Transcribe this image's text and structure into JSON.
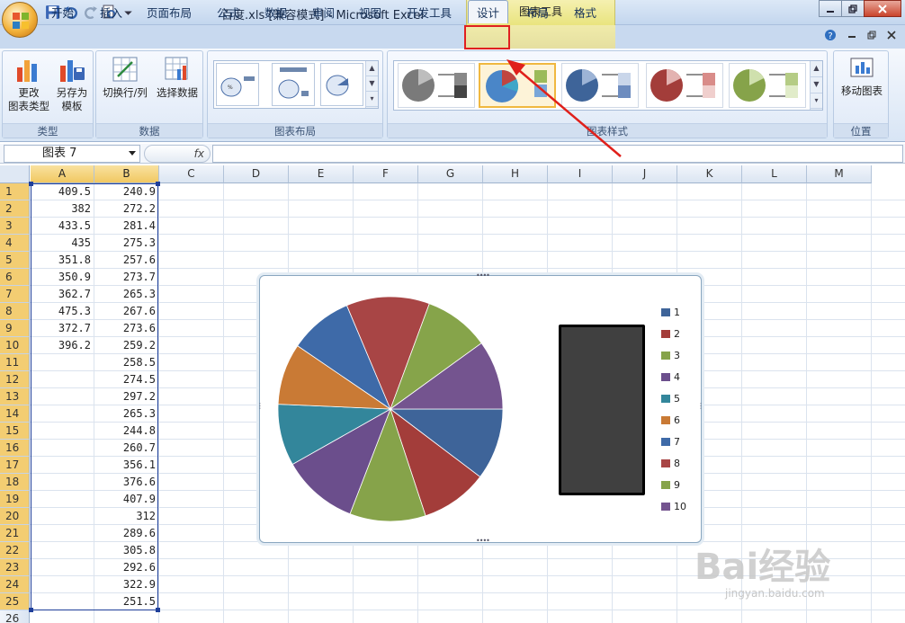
{
  "window": {
    "title": "百度.xls  [兼容模式] - Microsoft Excel",
    "context_title": "图表工具"
  },
  "tabs": [
    {
      "label": "开始"
    },
    {
      "label": "插入"
    },
    {
      "label": "页面布局"
    },
    {
      "label": "公式"
    },
    {
      "label": "数据"
    },
    {
      "label": "审阅"
    },
    {
      "label": "视图"
    },
    {
      "label": "开发工具"
    },
    {
      "label": "设计"
    },
    {
      "label": "布局"
    },
    {
      "label": "格式"
    }
  ],
  "active_tab": "设计",
  "ribbon": {
    "groups": {
      "type": {
        "label": "类型",
        "change_type": "更改\n图表类型",
        "save_template": "另存为\n模板"
      },
      "data": {
        "label": "数据",
        "switch_row_col": "切换行/列",
        "select_data": "选择数据"
      },
      "layout": {
        "label": "图表布局"
      },
      "styles": {
        "label": "图表样式"
      },
      "location": {
        "label": "位置",
        "move_chart": "移动图表"
      }
    }
  },
  "formula_bar": {
    "name_box": "图表 7",
    "fx": "fx",
    "content": ""
  },
  "columns": [
    "A",
    "B",
    "C",
    "D",
    "E",
    "F",
    "G",
    "H",
    "I",
    "J",
    "K",
    "L",
    "M"
  ],
  "rows": [
    {
      "n": "1",
      "a": "409.5",
      "b": "240.9"
    },
    {
      "n": "2",
      "a": "382",
      "b": "272.2"
    },
    {
      "n": "3",
      "a": "433.5",
      "b": "281.4"
    },
    {
      "n": "4",
      "a": "435",
      "b": "275.3"
    },
    {
      "n": "5",
      "a": "351.8",
      "b": "257.6"
    },
    {
      "n": "6",
      "a": "350.9",
      "b": "273.7"
    },
    {
      "n": "7",
      "a": "362.7",
      "b": "265.3"
    },
    {
      "n": "8",
      "a": "475.3",
      "b": "267.6"
    },
    {
      "n": "9",
      "a": "372.7",
      "b": "273.6"
    },
    {
      "n": "10",
      "a": "396.2",
      "b": "259.2"
    },
    {
      "n": "11",
      "a": "",
      "b": "258.5"
    },
    {
      "n": "12",
      "a": "",
      "b": "274.5"
    },
    {
      "n": "13",
      "a": "",
      "b": "297.2"
    },
    {
      "n": "14",
      "a": "",
      "b": "265.3"
    },
    {
      "n": "15",
      "a": "",
      "b": "244.8"
    },
    {
      "n": "16",
      "a": "",
      "b": "260.7"
    },
    {
      "n": "17",
      "a": "",
      "b": "356.1"
    },
    {
      "n": "18",
      "a": "",
      "b": "376.6"
    },
    {
      "n": "19",
      "a": "",
      "b": "407.9"
    },
    {
      "n": "20",
      "a": "",
      "b": "312"
    },
    {
      "n": "21",
      "a": "",
      "b": "289.6"
    },
    {
      "n": "22",
      "a": "",
      "b": "305.8"
    },
    {
      "n": "23",
      "a": "",
      "b": "292.6"
    },
    {
      "n": "24",
      "a": "",
      "b": "322.9"
    },
    {
      "n": "25",
      "a": "",
      "b": "251.5"
    },
    {
      "n": "26",
      "a": "",
      "b": ""
    }
  ],
  "chart_data": {
    "type": "pie",
    "categories": [
      "1",
      "2",
      "3",
      "4",
      "5",
      "6",
      "7",
      "8",
      "9",
      "10"
    ],
    "values": [
      409.5,
      382,
      433.5,
      435,
      351.8,
      350.9,
      362.7,
      475.3,
      372.7,
      396.2
    ],
    "colors": [
      "#3E6499",
      "#A33D3A",
      "#86A34A",
      "#6B4E8C",
      "#33869B",
      "#C97A35",
      "#3E6AA8",
      "#A84545",
      "#86A44A",
      "#74548F"
    ],
    "legend": "right"
  },
  "watermark": {
    "text": "Bai经验",
    "url": "jingyan.baidu.com"
  }
}
